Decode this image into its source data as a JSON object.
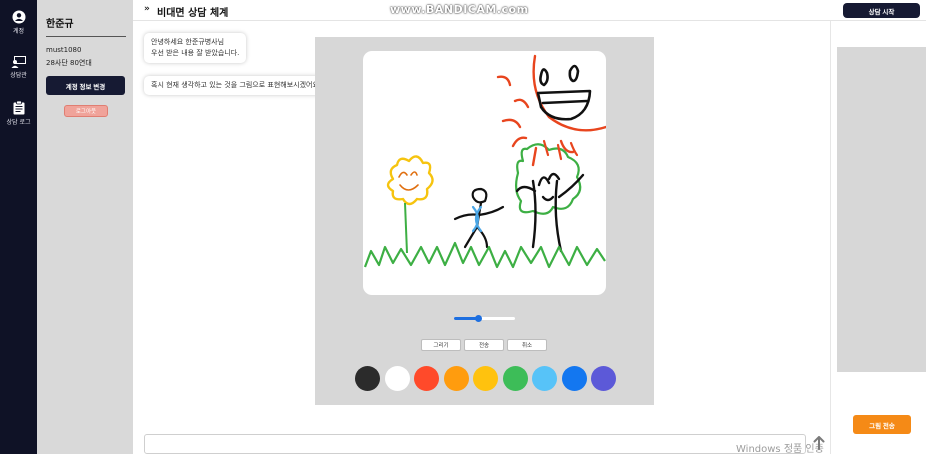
{
  "nav": {
    "items": [
      {
        "label": "계정",
        "icon": "account-icon"
      },
      {
        "label": "상담관",
        "icon": "consult-room-icon"
      },
      {
        "label": "상담 로그",
        "icon": "clipboard-icon"
      }
    ]
  },
  "account": {
    "name": "한준규",
    "user_id": "must1080",
    "age_group": "28사단 80연대",
    "edit_label": "계정 정보 변경",
    "logout_label": "로그아웃"
  },
  "header": {
    "title": "비대면 상담 체계",
    "start_label": "상담 시작"
  },
  "watermark": "www.BANDICAM.com",
  "chat": {
    "messages": [
      {
        "line1": "안녕하세요 한준규병사님",
        "line2": "우선 받은 내용 잘 받았습니다."
      },
      {
        "line1": "혹시 현재 생각하고 있는 것을 그림으로 표현해보시겠어요?"
      }
    ]
  },
  "drawing": {
    "brush_size": 0.4,
    "buttons": {
      "draw": "그리기",
      "send": "전송",
      "cancel": "취소"
    },
    "palette": [
      "#2b2b2b",
      "#ffffff",
      "#ff4a2a",
      "#ff9c0e",
      "#ffc20e",
      "#3dbd58",
      "#57c3f8",
      "#1377f0",
      "#5c59d8"
    ]
  },
  "actions": {
    "send_drawing_label": "그림 전송"
  },
  "message_input": {
    "value": ""
  },
  "system_overlay": {
    "text": "Windows 정품 인증"
  },
  "colors": {
    "navy": "#161a33",
    "accent_orange": "#f58a16",
    "panel_gray": "#d9d9d9"
  }
}
